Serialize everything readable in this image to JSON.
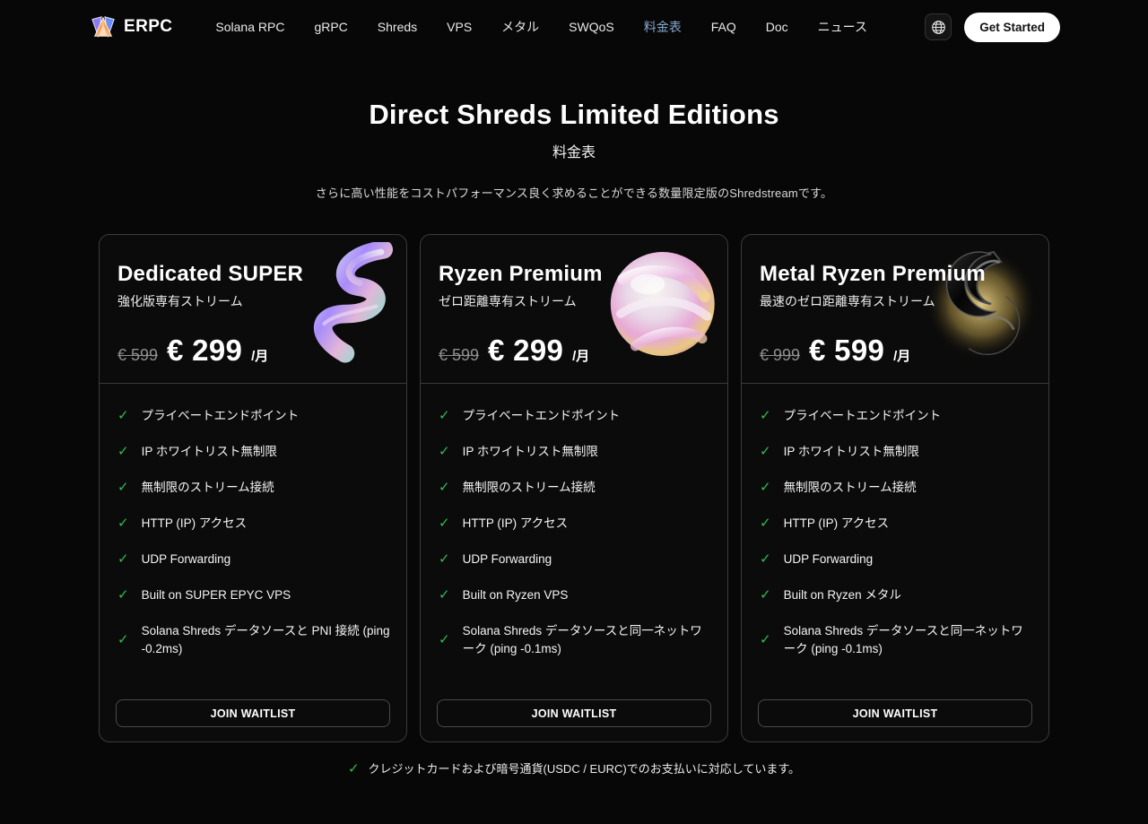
{
  "brand": {
    "name": "ERPC"
  },
  "nav": {
    "items": [
      "Solana RPC",
      "gRPC",
      "Shreds",
      "VPS",
      "メタル",
      "SWQoS",
      "料金表",
      "FAQ",
      "Doc",
      "ニュース"
    ],
    "active_index": 6,
    "get_started_label": "Get Started"
  },
  "hero": {
    "title": "Direct Shreds Limited Editions",
    "subtitle": "料金表",
    "description": "さらに高い性能をコストパフォーマンス良く求めることができる数量限定版のShredstreamです。"
  },
  "plans": [
    {
      "name": "Dedicated SUPER",
      "tagline": "強化版専有ストリーム",
      "old_price": "€ 599",
      "price": "€ 299",
      "period": "/月",
      "art": "iridescent-ribbon",
      "features": [
        "プライベートエンドポイント",
        "IP ホワイトリスト無制限",
        "無制限のストリーム接続",
        "HTTP (IP) アクセス",
        "UDP Forwarding",
        "Built on SUPER EPYC VPS",
        "Solana Shreds データソースと PNI 接続 (ping -0.2ms)"
      ],
      "cta_label": "JOIN WAITLIST"
    },
    {
      "name": "Ryzen Premium",
      "tagline": "ゼロ距離専有ストリーム",
      "old_price": "€ 599",
      "price": "€ 299",
      "period": "/月",
      "art": "pearl-sphere",
      "features": [
        "プライベートエンドポイント",
        "IP ホワイトリスト無制限",
        "無制限のストリーム接続",
        "HTTP (IP) アクセス",
        "UDP Forwarding",
        "Built on Ryzen VPS",
        "Solana Shreds データソースと同一ネットワーク (ping -0.1ms)"
      ],
      "cta_label": "JOIN WAITLIST"
    },
    {
      "name": "Metal Ryzen Premium",
      "tagline": "最速のゼロ距離専有ストリーム",
      "old_price": "€ 999",
      "price": "€ 599",
      "period": "/月",
      "art": "black-metal-rings",
      "features": [
        "プライベートエンドポイント",
        "IP ホワイトリスト無制限",
        "無制限のストリーム接続",
        "HTTP (IP) アクセス",
        "UDP Forwarding",
        "Built on Ryzen メタル",
        "Solana Shreds データソースと同一ネットワーク (ping -0.1ms)"
      ],
      "cta_label": "JOIN WAITLIST"
    }
  ],
  "footer_note": "クレジットカードおよび暗号通貨(USDC / EURC)でのお支払いに対応しています。",
  "icons": {
    "check": "✓"
  },
  "colors": {
    "accent_green": "#2dbd52",
    "nav_active_blue": "#85a8cc",
    "page_bg": "#070707",
    "card_bg": "#0b0b0b",
    "card_border": "#3b3b3b"
  }
}
